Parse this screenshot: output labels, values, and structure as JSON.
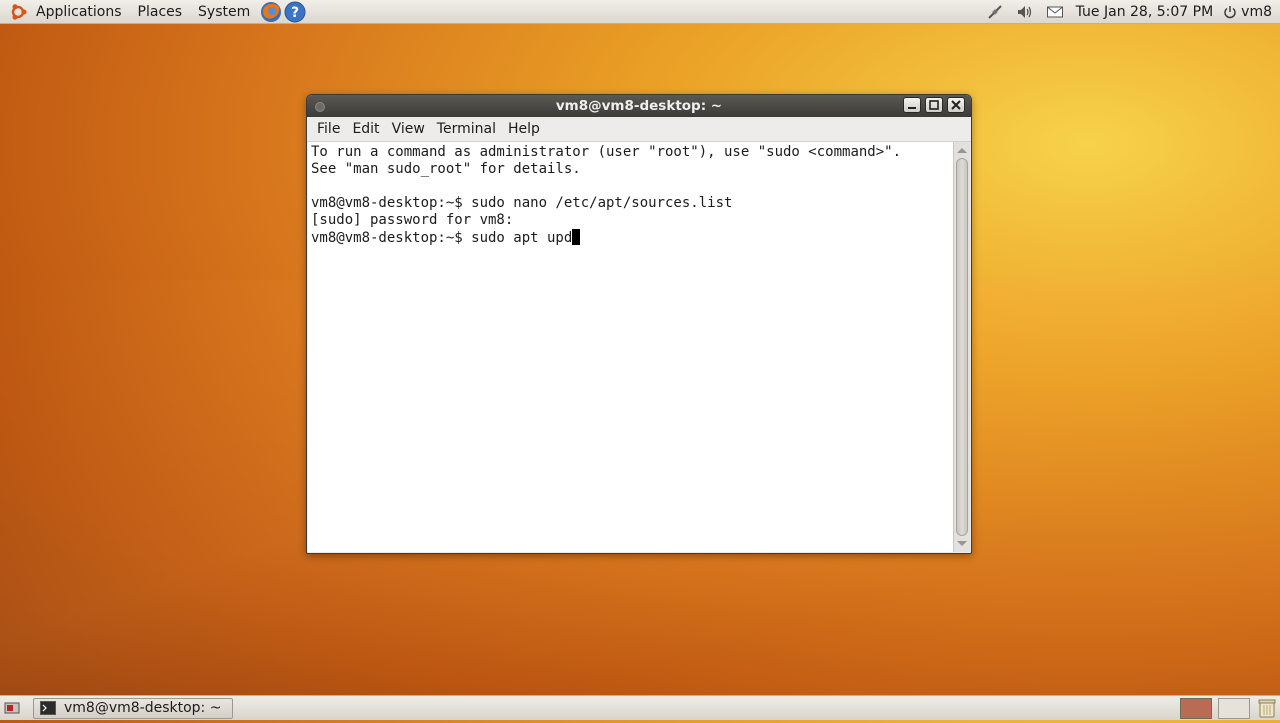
{
  "top_panel": {
    "menus": [
      "Applications",
      "Places",
      "System"
    ],
    "clock": "Tue Jan 28,  5:07 PM",
    "user": "vm8"
  },
  "window": {
    "title": "vm8@vm8-desktop: ~",
    "menu": [
      "File",
      "Edit",
      "View",
      "Terminal",
      "Help"
    ],
    "lines": [
      "To run a command as administrator (user \"root\"), use \"sudo <command>\".",
      "See \"man sudo_root\" for details.",
      "",
      "vm8@vm8-desktop:~$ sudo nano /etc/apt/sources.list",
      "[sudo] password for vm8: ",
      "vm8@vm8-desktop:~$ sudo apt upd"
    ]
  },
  "bottom_panel": {
    "task_label": "vm8@vm8-desktop: ~"
  },
  "colors": {
    "titlebar": "#3c3b37",
    "panel": "#dcd8cf",
    "wallpaper_accent": "#eba226"
  }
}
